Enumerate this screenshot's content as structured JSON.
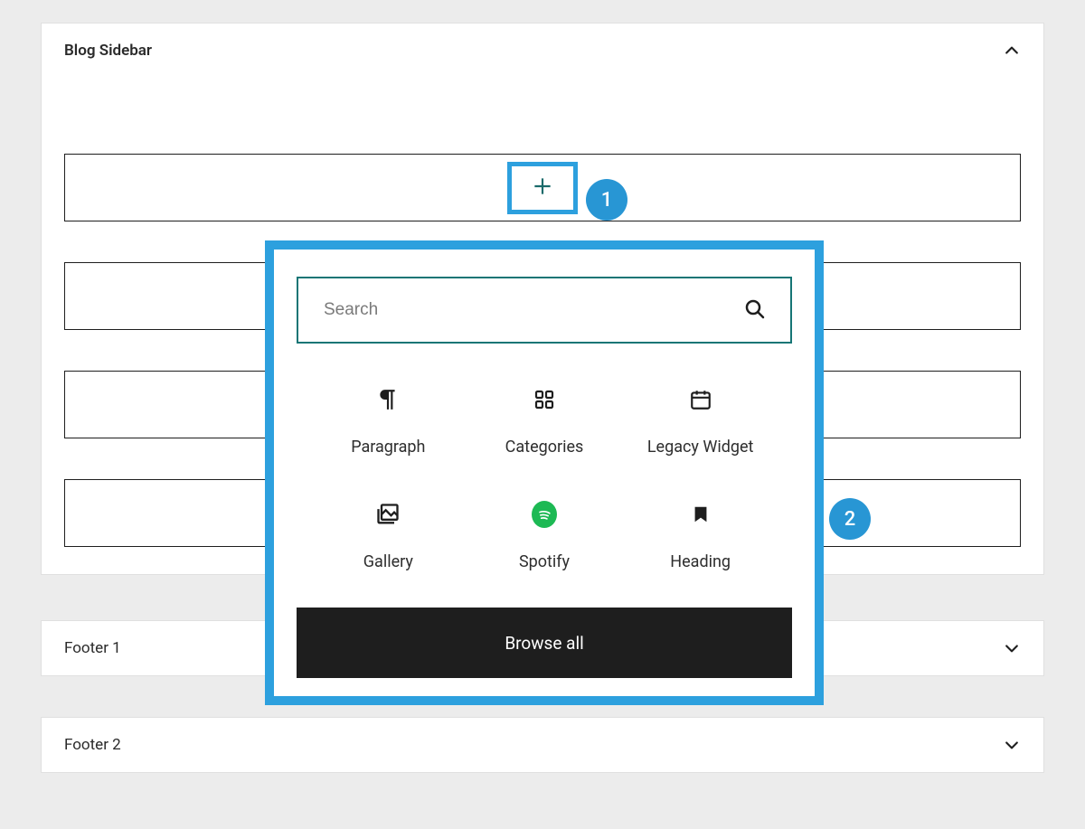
{
  "areas": {
    "blog_sidebar": {
      "title": "Blog Sidebar"
    },
    "footer_1": {
      "title": "Footer 1"
    },
    "footer_2": {
      "title": "Footer 2"
    }
  },
  "callouts": {
    "c1": "1",
    "c2": "2"
  },
  "inserter": {
    "search_placeholder": "Search",
    "browse_all": "Browse all",
    "blocks": {
      "paragraph": "Paragraph",
      "categories": "Categories",
      "legacy_widget": "Legacy Widget",
      "gallery": "Gallery",
      "spotify": "Spotify",
      "heading": "Heading"
    }
  }
}
